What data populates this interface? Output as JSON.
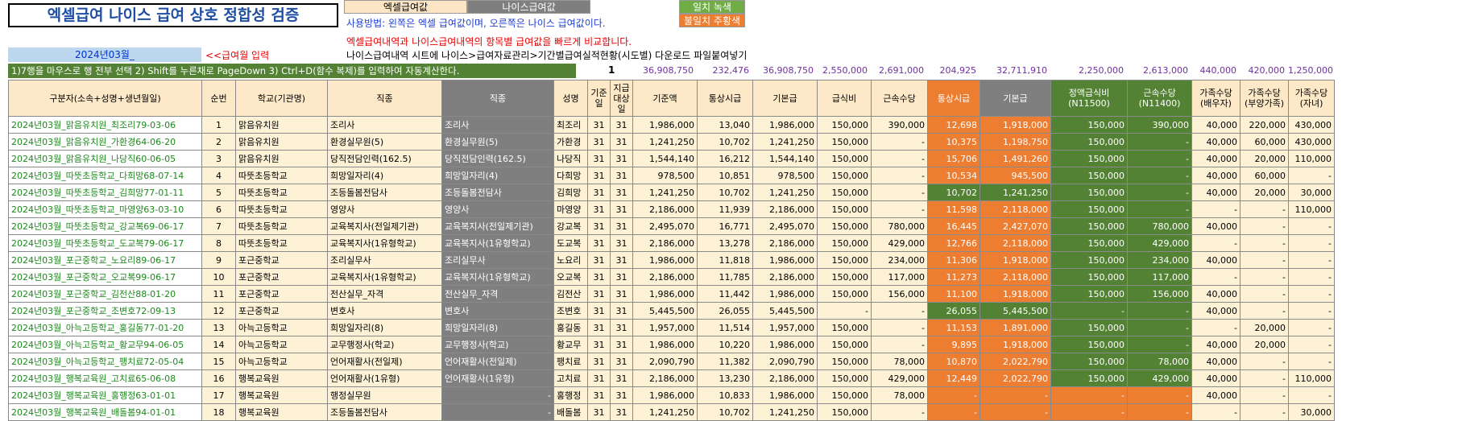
{
  "title": "엑셀급여 나이스 급여 상호 정합성 검증",
  "header_excel": "엑셀급여값",
  "header_neis": "나이스급여값",
  "legend_match": "일치 녹색",
  "legend_mismatch": "불일치 주황색",
  "usage": "사용방법: 왼쪽은 엑셀 급여값이며, 오른쪽은 나이스 급여값이다.",
  "compare": "엑셀급여내역과 나이스급여내역의 항목별 급여값을 빠르게 비교합니다.",
  "month": "2024년03월_",
  "month_hint": "<<급여월 입력",
  "guide": "나이스급여내역 시트에 나이스>급여자료관리>기간별급여실적현황(시도별) 다운로드 파일붙여넣기",
  "instruction": "1)7행을 마우스로 행 전부 선택  2) Shift를 누른채로 PageDown 3) Ctrl+D(함수 복제)를 입력하여 자동계산한다.",
  "marker": "1",
  "totals": [
    "36,908,750",
    "232,476",
    "36,908,750",
    "2,550,000",
    "2,691,000",
    "204,925",
    "32,711,910",
    "2,250,000",
    "2,613,000",
    "440,000",
    "420,000",
    "1,250,000"
  ],
  "columns": [
    "구분자(소속+성명+생년월일)",
    "순번",
    "학교(기관명)",
    "직종",
    "직종",
    "성명",
    "기준일",
    "지급대상일",
    "기준액",
    "통상시급",
    "기본급",
    "급식비",
    "근속수당",
    "통상시급",
    "기본급",
    "정액급식비(N11500)",
    "근속수당(N11400)",
    "가족수당(배우자)",
    "가족수당(부양가족)",
    "가족수당(자녀)"
  ],
  "rows": [
    [
      "2024년03월_맑음유치원_최조리79-03-06",
      "1",
      "맑음유치원",
      "조리사",
      "조리사",
      "최조리",
      "31",
      "31",
      "1,986,000",
      "13,040",
      "1,986,000",
      "150,000",
      "390,000",
      "12,698",
      "1,918,000",
      "150,000",
      "390,000",
      "40,000",
      "220,000",
      "430,000"
    ],
    [
      "2024년03월_맑음유치원_가환경64-06-20",
      "2",
      "맑음유치원",
      "환경실무원(5)",
      "환경실무원(5)",
      "가환경",
      "31",
      "31",
      "1,241,250",
      "10,702",
      "1,241,250",
      "150,000",
      "-",
      "10,375",
      "1,198,750",
      "150,000",
      "-",
      "40,000",
      "60,000",
      "430,000"
    ],
    [
      "2024년03월_맑음유치원_나당직60-06-05",
      "3",
      "맑음유치원",
      "당직전담인력(162.5)",
      "당직전담인력(162.5)",
      "나당직",
      "31",
      "31",
      "1,544,140",
      "16,212",
      "1,544,140",
      "150,000",
      "-",
      "15,706",
      "1,491,260",
      "150,000",
      "-",
      "40,000",
      "20,000",
      "110,000"
    ],
    [
      "2024년03월_따뜻초등학교_다희망68-07-14",
      "4",
      "따뜻초등학교",
      "희망일자리(4)",
      "희망일자리(4)",
      "다희망",
      "31",
      "31",
      "978,500",
      "10,851",
      "978,500",
      "150,000",
      "-",
      "10,534",
      "945,500",
      "150,000",
      "-",
      "40,000",
      "60,000",
      "-"
    ],
    [
      "2024년03월_따뜻초등학교_김희망77-01-11",
      "5",
      "따뜻초등학교",
      "조등돌봄전담사",
      "조등돌봄전담사",
      "김희망",
      "31",
      "31",
      "1,241,250",
      "10,702",
      "1,241,250",
      "150,000",
      "-",
      "10,702",
      "1,241,250",
      "150,000",
      "-",
      "40,000",
      "20,000",
      "30,000"
    ],
    [
      "2024년03월_따뜻초등학교_마영양63-03-10",
      "6",
      "따뜻초등학교",
      "영양사",
      "영양사",
      "마영양",
      "31",
      "31",
      "2,186,000",
      "11,939",
      "2,186,000",
      "150,000",
      "-",
      "11,598",
      "2,118,000",
      "150,000",
      "-",
      "-",
      "-",
      "110,000"
    ],
    [
      "2024년03월_따뜻초등학교_강교복69-06-17",
      "7",
      "따뜻초등학교",
      "교육복지사(전일제기관)",
      "교육복지사(전일제기관)",
      "강교복",
      "31",
      "31",
      "2,495,070",
      "16,771",
      "2,495,070",
      "150,000",
      "780,000",
      "16,445",
      "2,427,070",
      "150,000",
      "780,000",
      "40,000",
      "-",
      "-"
    ],
    [
      "2024년03월_따뜻초등학교_도교복79-06-17",
      "8",
      "따뜻초등학교",
      "교육복지사(1유형학교)",
      "교육복지사(1유형학교)",
      "도교복",
      "31",
      "31",
      "2,186,000",
      "13,278",
      "2,186,000",
      "150,000",
      "429,000",
      "12,766",
      "2,118,000",
      "150,000",
      "429,000",
      "-",
      "-",
      "-"
    ],
    [
      "2024년03월_포근중학교_노요리89-06-17",
      "9",
      "포근중학교",
      "조리실무사",
      "조리실무사",
      "노요리",
      "31",
      "31",
      "1,986,000",
      "11,818",
      "1,986,000",
      "150,000",
      "234,000",
      "11,306",
      "1,918,000",
      "150,000",
      "234,000",
      "40,000",
      "-",
      "-"
    ],
    [
      "2024년03월_포근중학교_오교복99-06-17",
      "10",
      "포근중학교",
      "교육복지사(1유형학교)",
      "교육복지사(1유형학교)",
      "오교복",
      "31",
      "31",
      "2,186,000",
      "11,785",
      "2,186,000",
      "150,000",
      "117,000",
      "11,273",
      "2,118,000",
      "150,000",
      "117,000",
      "-",
      "-",
      "-"
    ],
    [
      "2024년03월_포근중학교_김전산88-01-20",
      "11",
      "포근중학교",
      "전산실무_자격",
      "전산실무_자격",
      "김전산",
      "31",
      "31",
      "1,986,000",
      "11,442",
      "1,986,000",
      "150,000",
      "156,000",
      "11,100",
      "1,918,000",
      "150,000",
      "156,000",
      "40,000",
      "-",
      "-"
    ],
    [
      "2024년03월_포근중학교_조변호72-09-13",
      "12",
      "포근중학교",
      "변호사",
      "변호사",
      "조변호",
      "31",
      "31",
      "5,445,500",
      "26,055",
      "5,445,500",
      "-",
      "-",
      "26,055",
      "5,445,500",
      "-",
      "-",
      "40,000",
      "-",
      "-"
    ],
    [
      "2024년03월_아늑고등학교_홍길동77-01-20",
      "13",
      "아늑고등학교",
      "희망일자리(8)",
      "희망일자리(8)",
      "홍길동",
      "31",
      "31",
      "1,957,000",
      "11,514",
      "1,957,000",
      "150,000",
      "-",
      "11,153",
      "1,891,000",
      "150,000",
      "-",
      "-",
      "20,000",
      "-"
    ],
    [
      "2024년03월_아늑고등학교_황교무94-06-05",
      "14",
      "아늑고등학교",
      "교무행정사(학교)",
      "교무행정사(학교)",
      "황교무",
      "31",
      "31",
      "1,986,000",
      "10,220",
      "1,986,000",
      "150,000",
      "-",
      "9,895",
      "1,918,000",
      "150,000",
      "-",
      "40,000",
      "20,000",
      "-"
    ],
    [
      "2024년03월_아늑고등학교_팽치료72-05-04",
      "15",
      "아늑고등학교",
      "언어재활사(전일제)",
      "언어재활사(전일제)",
      "팽치료",
      "31",
      "31",
      "2,090,790",
      "11,382",
      "2,090,790",
      "150,000",
      "78,000",
      "10,870",
      "2,022,790",
      "150,000",
      "78,000",
      "40,000",
      "-",
      "-"
    ],
    [
      "2024년03월_행복교육원_고치료65-06-08",
      "16",
      "행복교육원",
      "언어재활사(1유형)",
      "언어재활사(1유형)",
      "고치료",
      "31",
      "31",
      "2,186,000",
      "13,230",
      "2,186,000",
      "150,000",
      "429,000",
      "12,449",
      "2,022,790",
      "150,000",
      "429,000",
      "40,000",
      "-",
      "110,000"
    ],
    [
      "2024년03월_행복교육원_홍행정63-01-01",
      "17",
      "행복교육원",
      "행정실무원",
      "-",
      "홍행정",
      "31",
      "31",
      "1,986,000",
      "10,833",
      "1,986,000",
      "150,000",
      "78,000",
      "-",
      "-",
      "-",
      "-",
      "40,000",
      "-",
      "-"
    ],
    [
      "2024년03월_행복교육원_배돌봄94-01-01",
      "18",
      "행복교육원",
      "조등돌봄전담사",
      "-",
      "배돌봄",
      "31",
      "31",
      "1,241,250",
      "10,702",
      "1,241,250",
      "150,000",
      "-",
      "-",
      "-",
      "-",
      "-",
      "-",
      "-",
      "30,000"
    ]
  ],
  "cell_colors": {
    "match": "#548235",
    "mismatch": "#ed7d31",
    "neis_gray": "#7f7f7f",
    "excel_bg": "#fef2d6"
  },
  "mismatch_cells": [
    [
      0,
      13
    ],
    [
      0,
      14
    ],
    [
      1,
      13
    ],
    [
      1,
      14
    ],
    [
      2,
      13
    ],
    [
      2,
      14
    ],
    [
      3,
      13
    ],
    [
      3,
      14
    ],
    [
      5,
      13
    ],
    [
      5,
      14
    ],
    [
      6,
      13
    ],
    [
      6,
      14
    ],
    [
      7,
      13
    ],
    [
      7,
      14
    ],
    [
      8,
      13
    ],
    [
      8,
      14
    ],
    [
      9,
      13
    ],
    [
      9,
      14
    ],
    [
      10,
      13
    ],
    [
      10,
      14
    ],
    [
      12,
      13
    ],
    [
      12,
      14
    ],
    [
      13,
      13
    ],
    [
      13,
      14
    ],
    [
      14,
      13
    ],
    [
      14,
      14
    ],
    [
      15,
      13
    ],
    [
      15,
      14
    ],
    [
      16,
      13
    ],
    [
      16,
      14
    ],
    [
      16,
      15
    ],
    [
      16,
      16
    ],
    [
      17,
      13
    ],
    [
      17,
      14
    ],
    [
      17,
      15
    ],
    [
      17,
      16
    ]
  ]
}
